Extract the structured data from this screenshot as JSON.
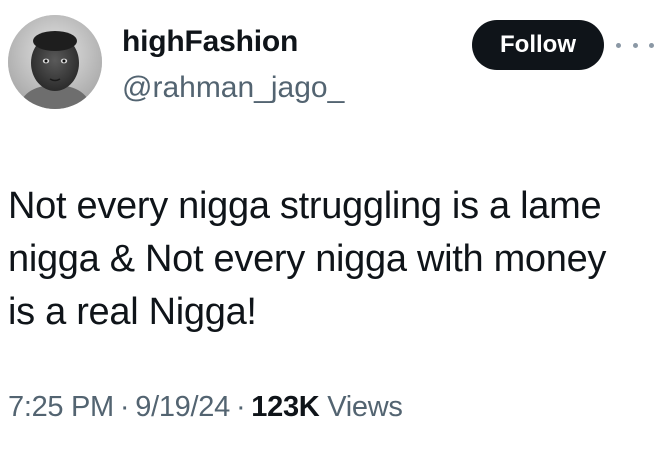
{
  "user": {
    "display_name": "highFashion",
    "handle": "@rahman_jago_",
    "avatar_icon": "avatar-child-portrait"
  },
  "actions": {
    "follow_label": "Follow",
    "more_icon": "more-horizontal-icon"
  },
  "tweet": {
    "lines": [
      "Not every nigga struggling is a lame",
      "nigga & Not every nigga with money",
      "is a real Nigga!"
    ]
  },
  "meta": {
    "time": "7:25 PM",
    "separator": "·",
    "date": "9/19/24",
    "views_count": "123K",
    "views_label": "Views"
  },
  "colors": {
    "text": "#0f1419",
    "muted": "#536471",
    "button_bg": "#0f1419",
    "button_text": "#ffffff"
  }
}
